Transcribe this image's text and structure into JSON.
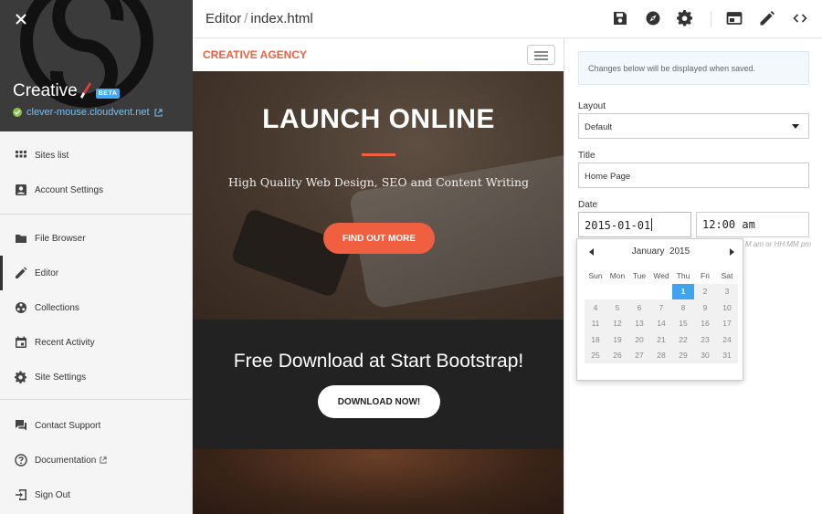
{
  "sidebar": {
    "site_name": "Creative",
    "badge": "BETA",
    "site_url": "clever-mouse.cloudvent.net",
    "items": [
      {
        "label": "Sites list",
        "icon": "grid-icon"
      },
      {
        "label": "Account Settings",
        "icon": "account-icon"
      },
      {
        "label": "File Browser",
        "icon": "folder-icon"
      },
      {
        "label": "Editor",
        "icon": "pencil-icon",
        "active": true
      },
      {
        "label": "Collections",
        "icon": "collections-icon"
      },
      {
        "label": "Recent Activity",
        "icon": "calendar-icon"
      },
      {
        "label": "Site Settings",
        "icon": "gear-icon"
      },
      {
        "label": "Contact Support",
        "icon": "chat-icon"
      },
      {
        "label": "Documentation",
        "icon": "help-icon"
      },
      {
        "label": "Sign Out",
        "icon": "sign-out-icon"
      }
    ]
  },
  "topbar": {
    "section": "Editor",
    "separator": "/",
    "file": "index.html",
    "icons": [
      "save-icon",
      "compass-icon",
      "gear-icon",
      "preview-window-icon",
      "pencil-icon",
      "code-icon"
    ]
  },
  "preview": {
    "brand": "CREATIVE AGENCY",
    "hero_title": "LAUNCH ONLINE",
    "hero_subtitle": "High Quality Web Design, SEO and Content Writing",
    "hero_button": "FIND OUT MORE",
    "download_title": "Free Download at Start Bootstrap!",
    "download_button": "DOWNLOAD NOW!"
  },
  "panel": {
    "notice": "Changes below will be displayed when saved.",
    "layout_label": "Layout",
    "layout_value": "Default",
    "title_label": "Title",
    "title_value": "Home Page",
    "date_label": "Date",
    "date_value": "2015-01-01",
    "time_value": "12:00 am",
    "time_hint": "M am or HH:MM pm"
  },
  "calendar": {
    "month": "January",
    "year": "2015",
    "weekdays": [
      "Sun",
      "Mon",
      "Tue",
      "Wed",
      "Thu",
      "Fri",
      "Sat"
    ],
    "selected_day": "1",
    "weeks": [
      [
        "",
        "",
        "",
        "",
        "1",
        "2",
        "3"
      ],
      [
        "4",
        "5",
        "6",
        "7",
        "8",
        "9",
        "10"
      ],
      [
        "11",
        "12",
        "13",
        "14",
        "15",
        "16",
        "17"
      ],
      [
        "18",
        "19",
        "20",
        "21",
        "22",
        "23",
        "24"
      ],
      [
        "25",
        "26",
        "27",
        "28",
        "29",
        "30",
        "31"
      ]
    ]
  },
  "colors": {
    "accent": "#f05f40",
    "sidebar_header": "#3b3b3b",
    "selected_day": "#3fa3f0",
    "beta_badge": "#3fa9f5"
  }
}
